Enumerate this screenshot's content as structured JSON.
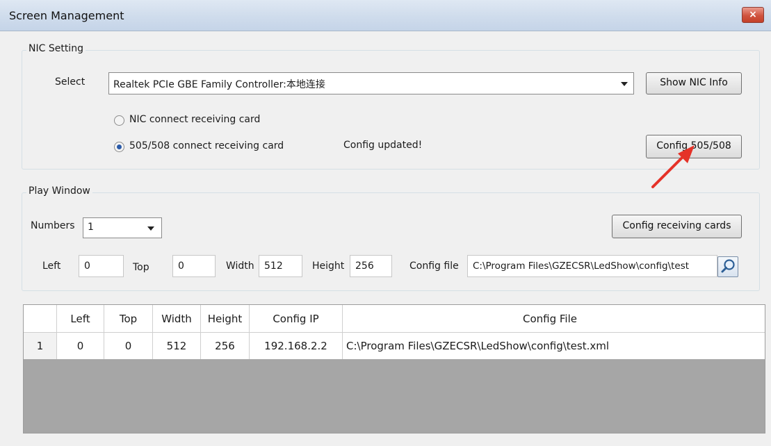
{
  "window": {
    "title": "Screen Management",
    "close_label": "×"
  },
  "nic": {
    "group_label": "NIC Setting",
    "select_label": "Select",
    "adapter_value": "Realtek PCIe GBE Family Controller:本地连接",
    "show_info_button": "Show NIC Info",
    "radio_nic": "NIC connect receiving card",
    "radio_505": "505/508 connect receiving card",
    "selected_mode": "505/508 connect receiving card",
    "status": "Config updated!",
    "config_button": "Config 505/508"
  },
  "play": {
    "group_label": "Play Window",
    "numbers_label": "Numbers",
    "numbers_value": "1",
    "config_cards_button": "Config receiving cards",
    "left_label": "Left",
    "left_value": "0",
    "top_label": "Top",
    "top_value": "0",
    "width_label": "Width",
    "width_value": "512",
    "height_label": "Height",
    "height_value": "256",
    "config_file_label": "Config file",
    "config_file_value": "C:\\Program Files\\GZECSR\\LedShow\\config\\test"
  },
  "table": {
    "columns": [
      "Left",
      "Top",
      "Width",
      "Height",
      "Config IP",
      "Config File"
    ],
    "rows": [
      {
        "num": "1",
        "left": "0",
        "top": "0",
        "width": "512",
        "height": "256",
        "ip": "192.168.2.2",
        "file": "C:\\Program Files\\GZECSR\\LedShow\\config\\test.xml"
      }
    ]
  },
  "colors": {
    "annotation_arrow": "#e53228",
    "table_empty_area": "#a6a6a6"
  },
  "icons": {
    "search": "magnifier-icon",
    "dropdown": "chevron-down-icon"
  }
}
